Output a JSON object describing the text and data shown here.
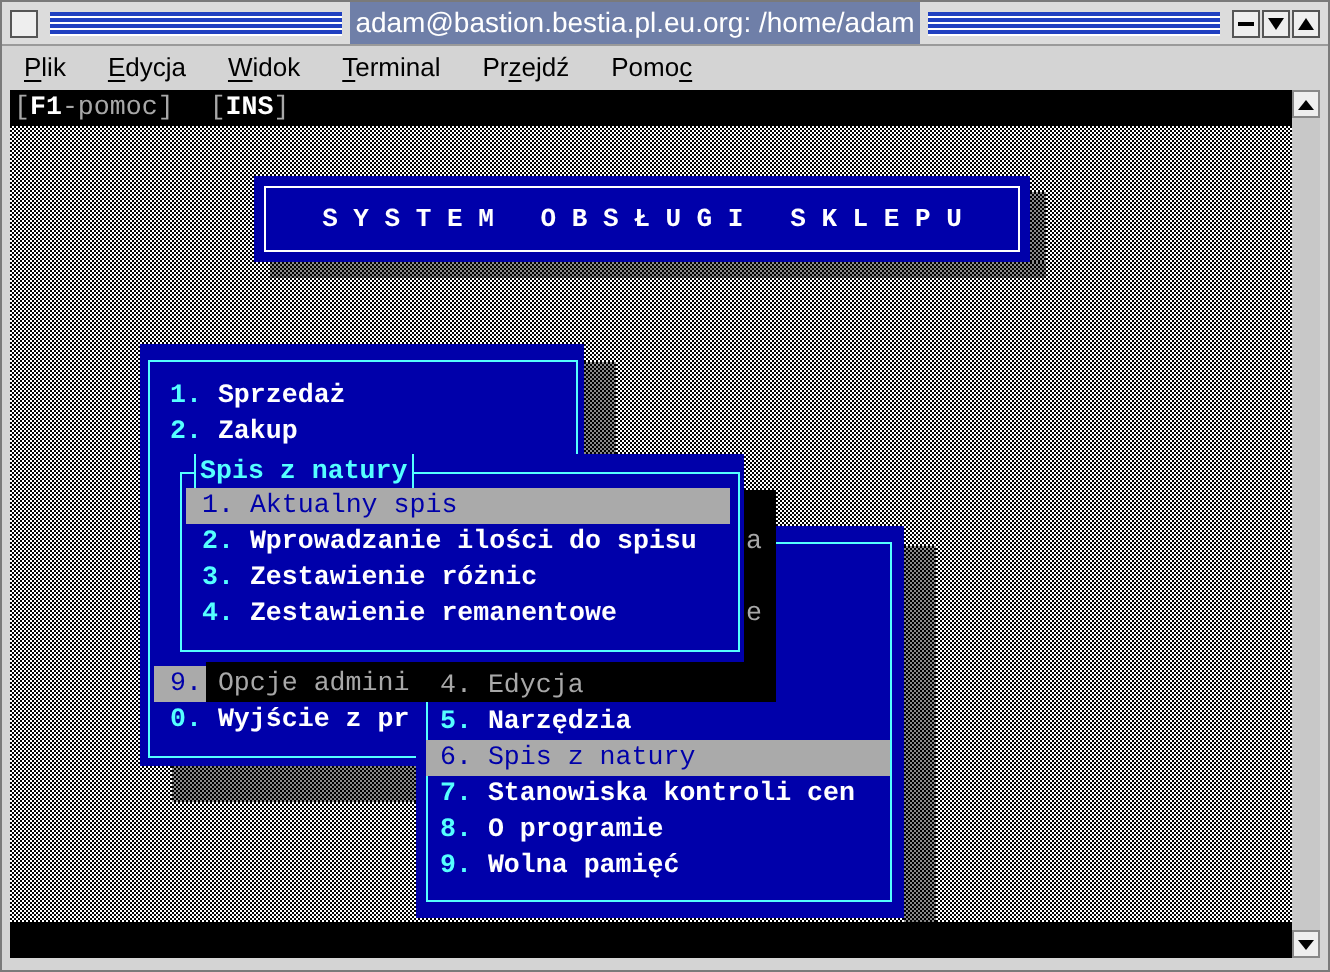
{
  "window": {
    "title": "adam@bastion.bestia.pl.eu.org: /home/adam"
  },
  "menubar": [
    {
      "label_parts": [
        {
          "text": "P",
          "underlined": true
        },
        {
          "text": "lik",
          "underlined": false
        }
      ]
    },
    {
      "label_parts": [
        {
          "text": "E",
          "underlined": true
        },
        {
          "text": "dycja",
          "underlined": false
        }
      ]
    },
    {
      "label_parts": [
        {
          "text": "W",
          "underlined": true
        },
        {
          "text": "idok",
          "underlined": false
        }
      ]
    },
    {
      "label_parts": [
        {
          "text": "T",
          "underlined": true
        },
        {
          "text": "erminal",
          "underlined": false
        }
      ]
    },
    {
      "label_parts": [
        {
          "text": "Pr",
          "underlined": false
        },
        {
          "text": "z",
          "underlined": true
        },
        {
          "text": "ejdź",
          "underlined": false
        }
      ]
    },
    {
      "label_parts": [
        {
          "text": "Pomo",
          "underlined": false
        },
        {
          "text": "c",
          "underlined": true
        }
      ]
    }
  ],
  "hint_bar": [
    "[**F1**-pomoc]",
    "[**INS**]"
  ],
  "banner": {
    "title": "S Y S T E M   O B S Ł U G I   S K L E P U"
  },
  "main_menu": {
    "items_top": [
      {
        "number": "1.",
        "label": "Sprzedaż",
        "selected": false,
        "shaded": false
      },
      {
        "number": "2.",
        "label": "Zakup",
        "selected": false,
        "shaded": false
      }
    ],
    "items_bottom": [
      {
        "number": "9.",
        "label": "Opcje admini",
        "selected": true,
        "shaded": true
      },
      {
        "number": "0.",
        "label": "Wyjście z pr",
        "selected": false,
        "shaded": false
      }
    ]
  },
  "submenu": {
    "title": "Spis z natury",
    "items": [
      {
        "number": "1.",
        "label": "Aktualny spis",
        "selected": true
      },
      {
        "number": "2.",
        "label": "Wprowadzanie ilości do spisu",
        "selected": false
      },
      {
        "number": "3.",
        "label": "Zestawienie różnic",
        "selected": false
      },
      {
        "number": "4.",
        "label": "Zestawienie remanentowe",
        "selected": false
      }
    ]
  },
  "shadow_fragments": [
    "a",
    "e"
  ],
  "lower_menu": {
    "items": [
      {
        "number": "4.",
        "label": "Edycja",
        "selected": false,
        "shaded": true
      },
      {
        "number": "5.",
        "label": "Narzędzia",
        "selected": false,
        "shaded": false
      },
      {
        "number": "6.",
        "label": "Spis z natury",
        "selected": true,
        "shaded": false
      },
      {
        "number": "7.",
        "label": "Stanowiska kontroli cen",
        "selected": false,
        "shaded": false
      },
      {
        "number": "8.",
        "label": "O programie",
        "selected": false,
        "shaded": false
      },
      {
        "number": "9.",
        "label": "Wolna pamięć",
        "selected": false,
        "shaded": false
      }
    ]
  }
}
